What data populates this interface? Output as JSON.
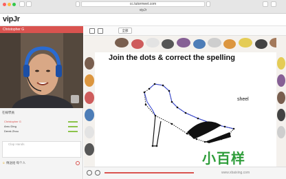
{
  "browser": {
    "url": "cc.tutormeet.com",
    "tab_title": "vipJr"
  },
  "app": {
    "logo": "vipJr"
  },
  "left_panel": {
    "tutor_name": "Christopher G",
    "users_heading": "在線學員",
    "users": [
      {
        "name": "Christopher G",
        "color": "#d9534f"
      },
      {
        "name": "Arnu Ding",
        "color": "#333333"
      },
      {
        "name": "Derek Zhou",
        "color": "#333333"
      }
    ],
    "chat_placeholder": "Clap Hands",
    "chat_target": "傳送給 每个人"
  },
  "toolbar": {
    "share_label": "全部"
  },
  "slide": {
    "title": "Join the dots & correct the spelling",
    "word": "sheel"
  },
  "watermark": {
    "text": "小百样",
    "url": "www.xbaixing.com"
  },
  "colors": {
    "accent": "#d9534f",
    "watermark": "#2e9d3a",
    "slide_line": "#2f3fd0"
  }
}
